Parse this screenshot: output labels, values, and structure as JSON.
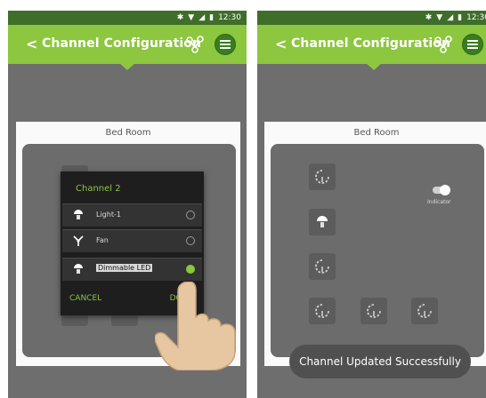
{
  "status_bar": {
    "time": "12:30",
    "bluetooth_icon": "bluetooth-icon",
    "wifi_icon": "wifi-icon",
    "signal_icon": "signal-icon",
    "battery_icon": "battery-icon"
  },
  "app_bar": {
    "back": "<",
    "title": "Channel Configuration",
    "share_icon": "share-network-icon",
    "menu_icon": "hamburger-menu-icon"
  },
  "left_screen": {
    "room_title": "Bed Room",
    "dialog": {
      "title": "Channel 2",
      "options": [
        {
          "label": "Light-1",
          "icon": "bulb-icon",
          "selected": false
        },
        {
          "label": "Fan",
          "icon": "fan-icon",
          "selected": false
        },
        {
          "label": "Dimmable LED",
          "icon": "dim-bulb-icon",
          "selected": true
        }
      ],
      "cancel": "CANCEL",
      "done": "DONE"
    }
  },
  "right_screen": {
    "room_title": "Bed Room",
    "indicator_label": "Indicator",
    "toast": "Channel Updated Successfully",
    "tiles": [
      "dim-bulb-icon",
      "bulb-icon",
      "dim-bulb-icon",
      "dim-bulb-icon",
      "dim-bulb-icon",
      "dim-bulb-icon"
    ]
  },
  "colors": {
    "app_bar": "#8dc63f",
    "status_bar": "#3f6e2a",
    "accent": "#8dc63f"
  }
}
